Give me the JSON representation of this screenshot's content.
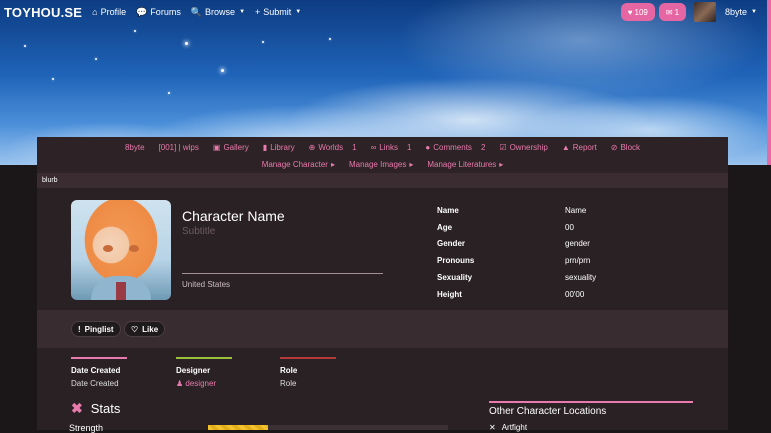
{
  "nav": {
    "brand": "TOYHOU.SE",
    "profile": "Profile",
    "forums": "Forums",
    "browse": "Browse",
    "submit": "Submit",
    "notifications_count": "109",
    "messages_count": "1",
    "username": "8byte"
  },
  "char_nav": {
    "owner": "8byte",
    "folder": "[001] | wips",
    "gallery": "Gallery",
    "library": "Library",
    "worlds": "Worlds",
    "worlds_count": "1",
    "links": "Links",
    "links_count": "1",
    "comments": "Comments",
    "comments_count": "2",
    "ownership": "Ownership",
    "report": "Report",
    "block": "Block",
    "manage_character": "Manage Character",
    "manage_images": "Manage Images",
    "manage_literatures": "Manage Literatures"
  },
  "blurb": "blurb",
  "character": {
    "name": "Character Name",
    "subtitle": "Subtitle",
    "location": "United States"
  },
  "details": [
    {
      "key": "Name",
      "value": "Name"
    },
    {
      "key": "Age",
      "value": "00"
    },
    {
      "key": "Gender",
      "value": "gender"
    },
    {
      "key": "Pronouns",
      "value": "prn/prn"
    },
    {
      "key": "Sexuality",
      "value": "sexuality"
    },
    {
      "key": "Height",
      "value": "00'00"
    }
  ],
  "actions": {
    "pinglist": "Pinglist",
    "like": "Like"
  },
  "credits": {
    "date_created_title": "Date Created",
    "date_created_value": "Date Created",
    "designer_title": "Designer",
    "designer_value": "designer",
    "role_title": "Role",
    "role_value": "Role"
  },
  "stats": {
    "heading": "Stats",
    "strength_label": "Strength",
    "strength_fill_fraction": 0.25
  },
  "other_locations": {
    "heading": "Other Character Locations",
    "first": "Artfight"
  },
  "colors": {
    "accent_pink": "#e97aad",
    "date_line": "#e97aad",
    "designer_line": "#9bbf3a",
    "role_line": "#b23a3a"
  }
}
